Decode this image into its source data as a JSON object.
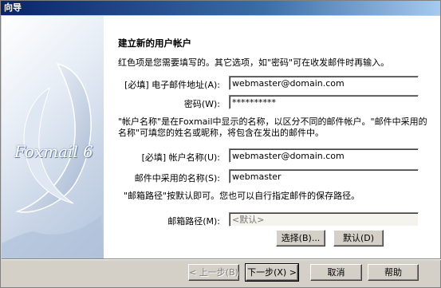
{
  "window": {
    "title": "向导"
  },
  "banner": {
    "brand_text": "Foxmail 6"
  },
  "page": {
    "heading": "建立新的用户帐户",
    "intro": "红色项是您需要填写的。其它选项，如\"密码\"可在收发邮件时再输入。",
    "email": {
      "label": "[必填] 电子邮件地址(A):",
      "value": "webmaster@domain.com"
    },
    "password": {
      "label": "密码(W):",
      "value": "**********"
    },
    "account_desc_1": "\"帐户名称\"是在Foxmail中显示的名称，以区分不同的邮件帐户。\"邮件中采用的",
    "account_desc_2": "名称\"可填您的姓名或昵称，将包含在发出的邮件中。",
    "account_name": {
      "label": "[必填] 帐户名称(U):",
      "value": "webmaster@domain.com"
    },
    "display_name": {
      "label": "邮件中采用的名称(S):",
      "value": "webmaster"
    },
    "mailbox_desc": "\"邮箱路径\"按默认即可。您也可以自行指定邮件的保存路径。",
    "mailbox_path": {
      "label": "邮箱路径(M):",
      "placeholder": "<默认>"
    },
    "choose_button": "选择(B)...",
    "default_button": "默认(D)"
  },
  "footer": {
    "back_button": "< 上一步(B)",
    "next_button": "下一步(X) >",
    "cancel_button": "取消",
    "help_button": "帮助"
  }
}
